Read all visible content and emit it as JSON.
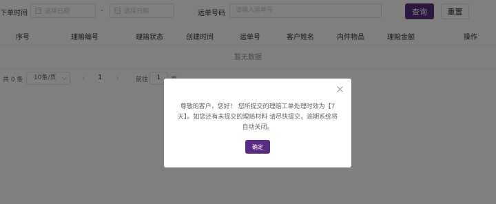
{
  "filters": {
    "order_time_label": "下单时间",
    "start_date_placeholder": "选择日期",
    "range_separator": "-",
    "end_date_placeholder": "选择日期",
    "waybill_label": "运单号码",
    "waybill_placeholder": "请输入运单号",
    "query_label": "查询",
    "reset_label": "重置"
  },
  "table": {
    "columns": [
      "序号",
      "理赔编号",
      "理赔状态",
      "创建时间",
      "运单号",
      "客户姓名",
      "内件物品",
      "理赔金额",
      "操作"
    ],
    "empty_text": "暂无数据"
  },
  "pagination": {
    "total_text": "共 0 条",
    "page_size": "10条/页",
    "prev_icon": "chevron-left-icon",
    "current_page": "1",
    "next_icon": "chevron-right-icon",
    "goto_label": "前往",
    "goto_value": "1",
    "goto_suffix": "页"
  },
  "dialog": {
    "message": "尊敬的客户，您好！ 您所提交的理赔工单处理时效为【7天】。如您还有未提交的理赔材料 请尽快提交，逾期系统将自动关闭。",
    "confirm_label": "确定"
  },
  "colors": {
    "primary": "#5b2c83",
    "overlay": "rgba(0,0,0,0.5)"
  }
}
